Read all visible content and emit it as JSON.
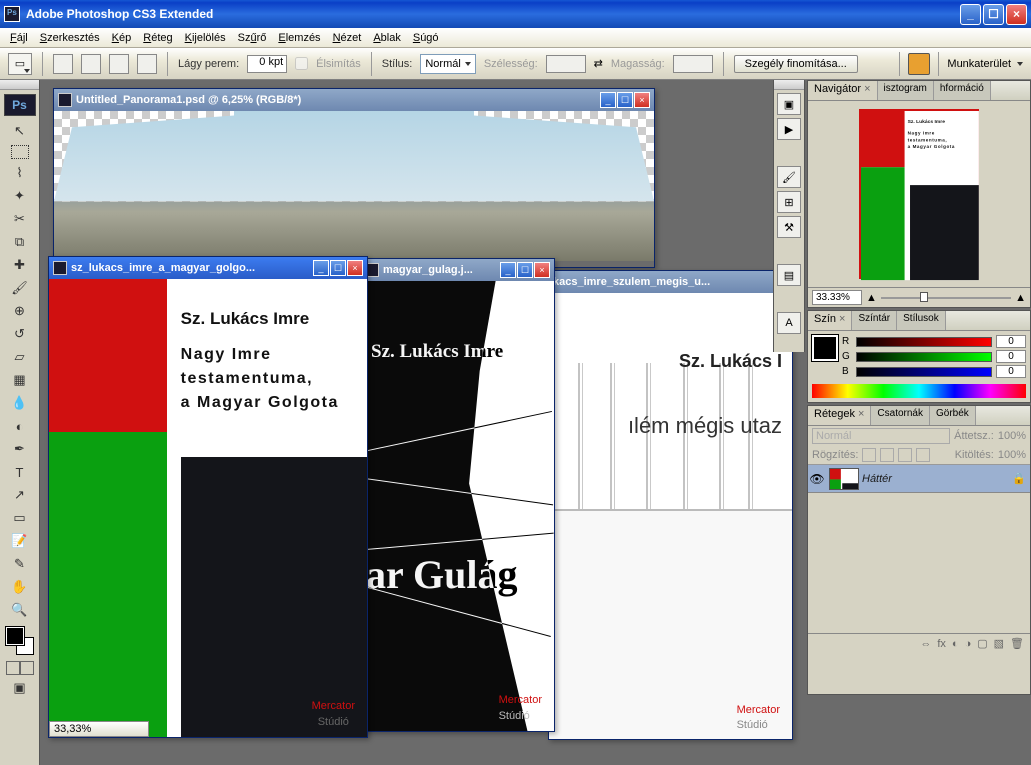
{
  "app": {
    "title": "Adobe Photoshop CS3 Extended"
  },
  "menu": {
    "file": "Fájl",
    "edit": "Szerkesztés",
    "image": "Kép",
    "layer": "Réteg",
    "select": "Kijelölés",
    "filter": "Szűrő",
    "analysis": "Elemzés",
    "view": "Nézet",
    "window": "Ablak",
    "help": "Súgó"
  },
  "options": {
    "feather_label": "Lágy perem:",
    "feather_value": "0 kpt",
    "antialias": "Élsimítás",
    "style_label": "Stílus:",
    "style_value": "Normál",
    "width_label": "Szélesség:",
    "height_label": "Magasság:",
    "refine": "Szegély finomítása...",
    "workspace": "Munkaterület"
  },
  "docs": {
    "panorama": {
      "title": "Untitled_Panorama1.psd @ 6,25% (RGB/8*)"
    },
    "golgota": {
      "title": "sz_lukacs_imre_a_magyar_golgo...",
      "author": "Sz. Lukács Imre",
      "line1": "Nagy Imre",
      "line2": "testamentuma,",
      "line3": "a Magyar Golgota",
      "status_zoom": "33,33%"
    },
    "gulag": {
      "title": "magyar_gulag.j...",
      "author": "Sz. Lukács Imre",
      "titletext": "ar Gulág"
    },
    "szulem": {
      "title": "kacs_imre_szulem_megis_u...",
      "author": "Sz. Lukács I",
      "titletext": "ılém mégis utaz"
    },
    "publisher": {
      "name": "Mercator",
      "sub": "Stúdió"
    }
  },
  "panels": {
    "navigator": {
      "tab": "Navigátor",
      "histogram": "isztogram",
      "info": "hformáció",
      "zoom": "33.33%"
    },
    "color": {
      "tab": "Szín",
      "swatches": "Színtár",
      "styles": "Stílusok",
      "r": "R",
      "g": "G",
      "b": "B",
      "rv": "0",
      "gv": "0",
      "bv": "0"
    },
    "layers": {
      "tab": "Rétegek",
      "channels": "Csatornák",
      "curves": "Görbék",
      "blend": "Normál",
      "opacity_label": "Áttetsz.:",
      "opacity": "100%",
      "lock_label": "Rögzítés:",
      "fill_label": "Kitöltés:",
      "fill": "100%",
      "layer_name": "Háttér"
    }
  },
  "navthumb": {
    "author": "Sz. Lukács Imre",
    "l1": "Nagy Imre",
    "l2": "testamentuma,",
    "l3": "a Magyar Golgota"
  }
}
